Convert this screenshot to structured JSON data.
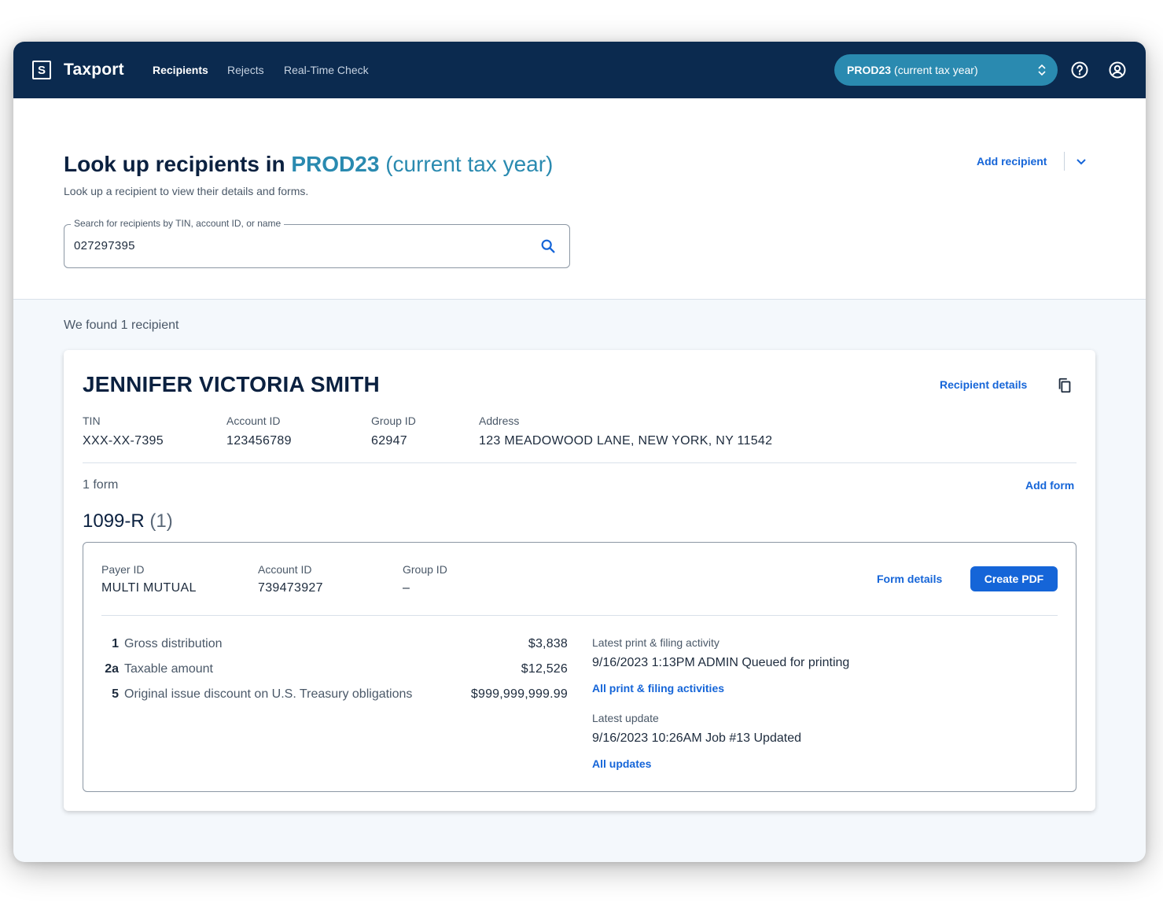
{
  "app": {
    "logo_letter": "S",
    "name": "Taxport",
    "nav": [
      {
        "label": "Recipients",
        "active": true
      },
      {
        "label": "Rejects",
        "active": false
      },
      {
        "label": "Real-Time Check",
        "active": false
      }
    ],
    "env_select": {
      "code": "PROD23",
      "label": "(current tax year)"
    },
    "icons": [
      "help-icon",
      "account-icon"
    ]
  },
  "page": {
    "title_prefix": "Look up recipients in",
    "title_env": "PROD23",
    "title_env_sub": "(current tax year)",
    "subtitle": "Look up a recipient to view their details and forms.",
    "add_recipient_label": "Add recipient",
    "search": {
      "label": "Search for recipients by TIN, account ID, or name",
      "value": "027297395"
    },
    "results_text": "We found 1 recipient"
  },
  "recipient": {
    "name": "JENNIFER VICTORIA SMITH",
    "details_link": "Recipient details",
    "fields": [
      {
        "label": "TIN",
        "value": "XXX-XX-7395"
      },
      {
        "label": "Account ID",
        "value": "123456789"
      },
      {
        "label": "Group ID",
        "value": "62947"
      },
      {
        "label": "Address",
        "value": "123 MEADOWOOD LANE, NEW YORK, NY 11542"
      }
    ],
    "form_count": "1 form",
    "add_form_label": "Add form",
    "form_type": "1099-R",
    "form_type_count": "(1)",
    "form": {
      "fields": [
        {
          "label": "Payer ID",
          "value": "MULTI MUTUAL"
        },
        {
          "label": "Account ID",
          "value": "739473927"
        },
        {
          "label": "Group ID",
          "value": "–"
        }
      ],
      "form_details_label": "Form details",
      "create_pdf_label": "Create PDF",
      "boxes": [
        {
          "num": "1",
          "label": "Gross distribution",
          "amount": "$3,838"
        },
        {
          "num": "2a",
          "label": "Taxable amount",
          "amount": "$12,526"
        },
        {
          "num": "5",
          "label": "Original issue discount on U.S. Treasury obligations",
          "amount": "$999,999,999.99"
        }
      ],
      "latest_print_label": "Latest print & filing activity",
      "latest_print_value": "9/16/2023 1:13PM ADMIN Queued for printing",
      "all_print_link": "All print & filing activities",
      "latest_update_label": "Latest update",
      "latest_update_value": "9/16/2023 10:26AM Job #13 Updated",
      "all_updates_link": "All updates"
    }
  },
  "colors": {
    "header_bg": "#0b2a4f",
    "accent_teal": "#2a8ab0",
    "link_blue": "#1565d8",
    "content_bg": "#f4f8fc"
  }
}
